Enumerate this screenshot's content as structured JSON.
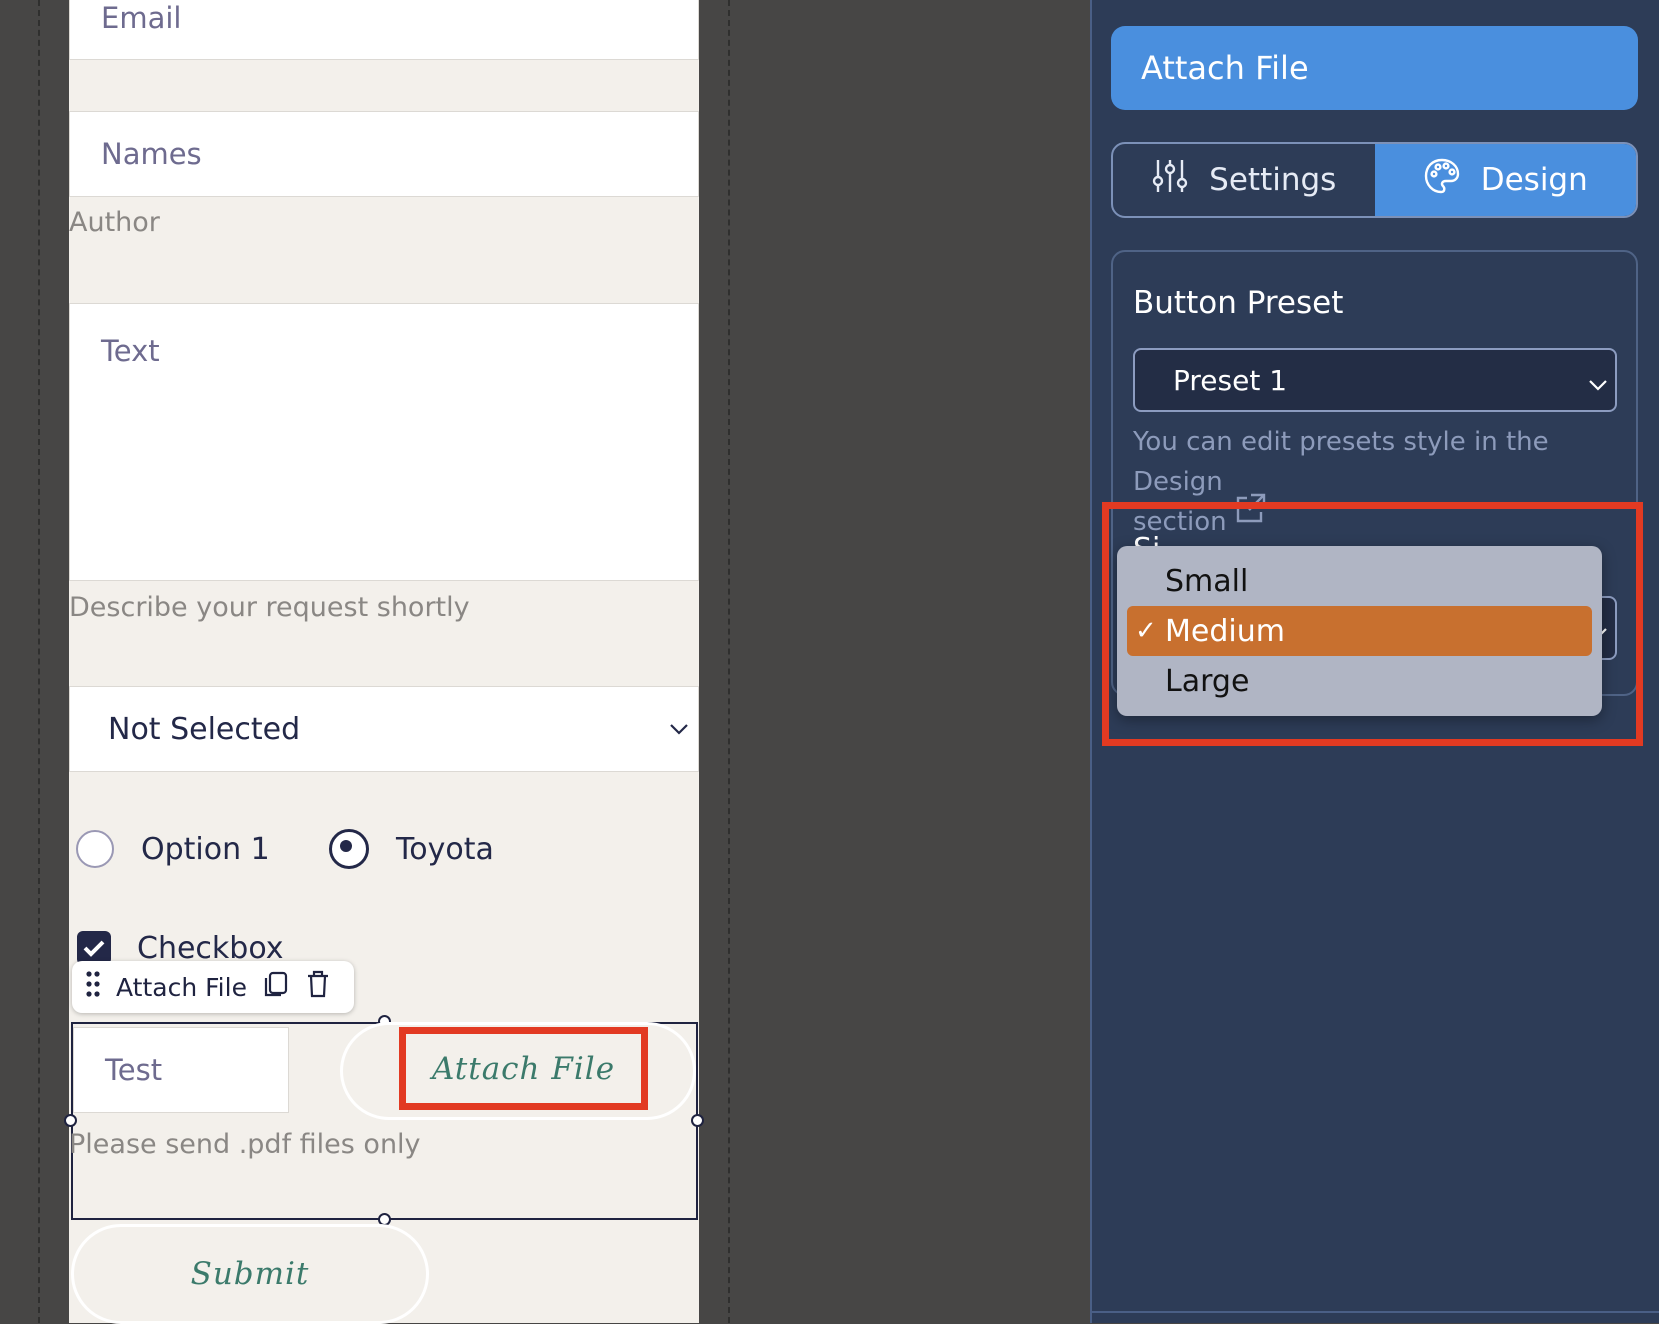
{
  "form": {
    "email_placeholder": "Email",
    "names_placeholder": "Names",
    "author_label": "Author",
    "text_placeholder": "Text",
    "text_hint": "Describe your request shortly",
    "select_value": "Not Selected",
    "radio_options": [
      "Option 1",
      "Toyota"
    ],
    "radio_selected": "Toyota",
    "checkbox_label": "Checkbox",
    "checkbox_checked": true,
    "element_toolbar_label": "Attach File",
    "file_input_placeholder": "Test",
    "attach_button_label": "Attach File",
    "file_hint": "Please send .pdf files only",
    "submit_label": "Submit"
  },
  "panel": {
    "header_title": "Attach File",
    "tabs": [
      {
        "label": "Settings",
        "active": false
      },
      {
        "label": "Design",
        "active": true
      }
    ],
    "button_preset_title": "Button Preset",
    "preset_value": "Preset 1",
    "preset_help_line1": "You can edit presets style in the Design",
    "preset_help_line2": "section",
    "size_options": [
      "Small",
      "Medium",
      "Large"
    ],
    "size_selected": "Medium"
  },
  "colors": {
    "canvas_bg": "#474645",
    "form_bg": "#f3f0eb",
    "panel_bg": "#2d3c57",
    "accent_blue": "#4a8fde",
    "highlight_red": "#e23a22",
    "dropdown_selected": "#c8702f",
    "button_text_green": "#3b7a6b"
  }
}
